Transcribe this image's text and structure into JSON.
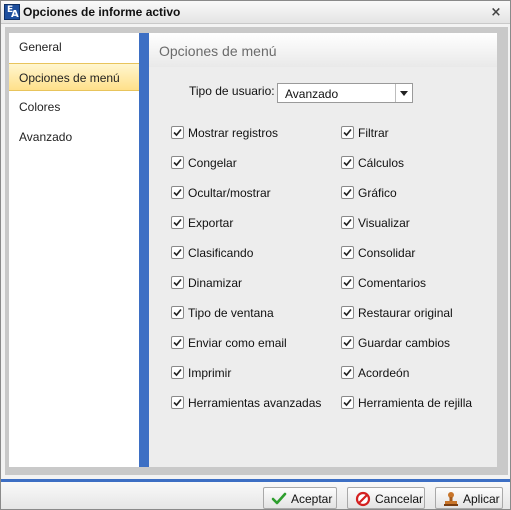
{
  "window": {
    "title": "Opciones de informe activo",
    "close_symbol": "×",
    "icon_letters": [
      "E",
      "A"
    ]
  },
  "sidebar": {
    "items": [
      {
        "label": "General",
        "active": false
      },
      {
        "label": "Opciones de menú",
        "active": true
      },
      {
        "label": "Colores",
        "active": false
      },
      {
        "label": "Avanzado",
        "active": false
      }
    ]
  },
  "panel": {
    "title": "Opciones de menú",
    "user_type_label": "Tipo de usuario:",
    "user_type_value": "Avanzado",
    "left_options": [
      {
        "label": "Mostrar registros",
        "checked": true
      },
      {
        "label": "Congelar",
        "checked": true
      },
      {
        "label": "Ocultar/mostrar",
        "checked": true
      },
      {
        "label": "Exportar",
        "checked": true
      },
      {
        "label": "Clasificando",
        "checked": true
      },
      {
        "label": "Dinamizar",
        "checked": true
      },
      {
        "label": "Tipo de ventana",
        "checked": true
      },
      {
        "label": "Enviar como email",
        "checked": true
      },
      {
        "label": "Imprimir",
        "checked": true
      },
      {
        "label": "Herramientas avanzadas",
        "checked": true
      }
    ],
    "right_options": [
      {
        "label": "Filtrar",
        "checked": true
      },
      {
        "label": "Cálculos",
        "checked": true
      },
      {
        "label": "Gráfico",
        "checked": true
      },
      {
        "label": "Visualizar",
        "checked": true
      },
      {
        "label": "Consolidar",
        "checked": true
      },
      {
        "label": "Comentarios",
        "checked": true
      },
      {
        "label": "Restaurar original",
        "checked": true
      },
      {
        "label": "Guardar cambios",
        "checked": true
      },
      {
        "label": "Acordeón",
        "checked": true
      },
      {
        "label": "Herramienta de rejilla",
        "checked": true
      }
    ]
  },
  "footer": {
    "accept_label": "Aceptar",
    "cancel_label": "Cancelar",
    "apply_label": "Aplicar"
  },
  "colors": {
    "accent": "#3d6fc4",
    "active_nav": "#ffe08a",
    "check_green": "#2e9e2e",
    "cancel_red": "#d42020"
  }
}
